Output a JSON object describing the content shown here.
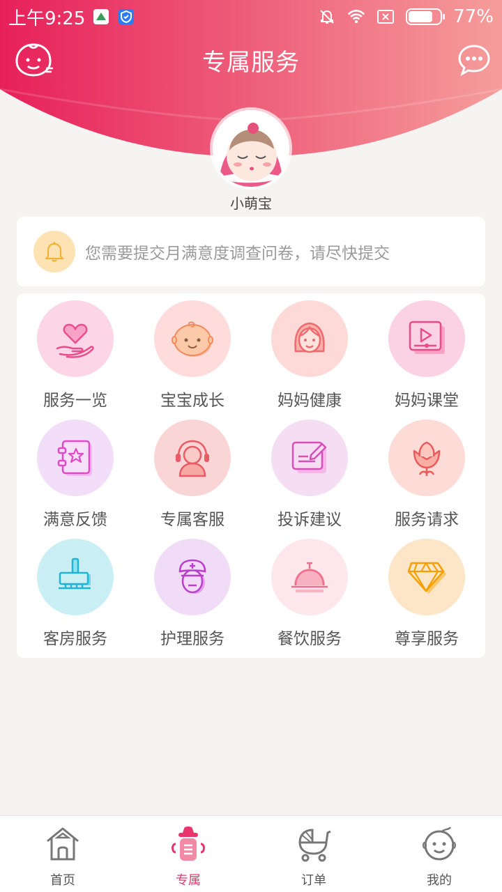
{
  "status_bar": {
    "time": "上午9:25",
    "battery": "77%",
    "battery_level": 0.77
  },
  "header": {
    "title": "专属服务",
    "left_icon": "baby-face-icon",
    "right_icon": "chat-bubble-icon"
  },
  "profile": {
    "name": "小萌宝",
    "avatar_icon": "sleeping-baby-avatar"
  },
  "notice": {
    "icon": "bell-icon",
    "text": "您需要提交月满意度调查问卷，请尽快提交"
  },
  "services": [
    {
      "label": "服务一览",
      "icon": "heart-hand-icon",
      "bg": "#fcd6e6"
    },
    {
      "label": "宝宝成长",
      "icon": "baby-icon",
      "bg": "#fddcdb"
    },
    {
      "label": "妈妈健康",
      "icon": "mother-icon",
      "bg": "#fdd9d8"
    },
    {
      "label": "妈妈课堂",
      "icon": "video-icon",
      "bg": "#fbd2e3"
    },
    {
      "label": "满意反馈",
      "icon": "star-notebook-icon",
      "bg": "#f2def9"
    },
    {
      "label": "专属客服",
      "icon": "headset-agent-icon",
      "bg": "#f9d6d5"
    },
    {
      "label": "投诉建议",
      "icon": "edit-document-icon",
      "bg": "#f5def3"
    },
    {
      "label": "服务请求",
      "icon": "tulip-icon",
      "bg": "#fddbd7"
    },
    {
      "label": "客房服务",
      "icon": "broom-icon",
      "bg": "#c9eff5"
    },
    {
      "label": "护理服务",
      "icon": "nurse-icon",
      "bg": "#f1dcf8"
    },
    {
      "label": "餐饮服务",
      "icon": "food-cloche-icon",
      "bg": "#fde6ec"
    },
    {
      "label": "尊享服务",
      "icon": "diamond-icon",
      "bg": "#fde6c7"
    }
  ],
  "tabs": [
    {
      "label": "首页",
      "icon": "home-icon",
      "active": false
    },
    {
      "label": "专属",
      "icon": "baby-bottle-icon",
      "active": true
    },
    {
      "label": "订单",
      "icon": "stroller-icon",
      "active": false
    },
    {
      "label": "我的",
      "icon": "profile-baby-icon",
      "active": false
    }
  ],
  "colors": {
    "header_start": "#e8245a",
    "header_end": "#f59a9a",
    "accent": "#e8356d"
  }
}
